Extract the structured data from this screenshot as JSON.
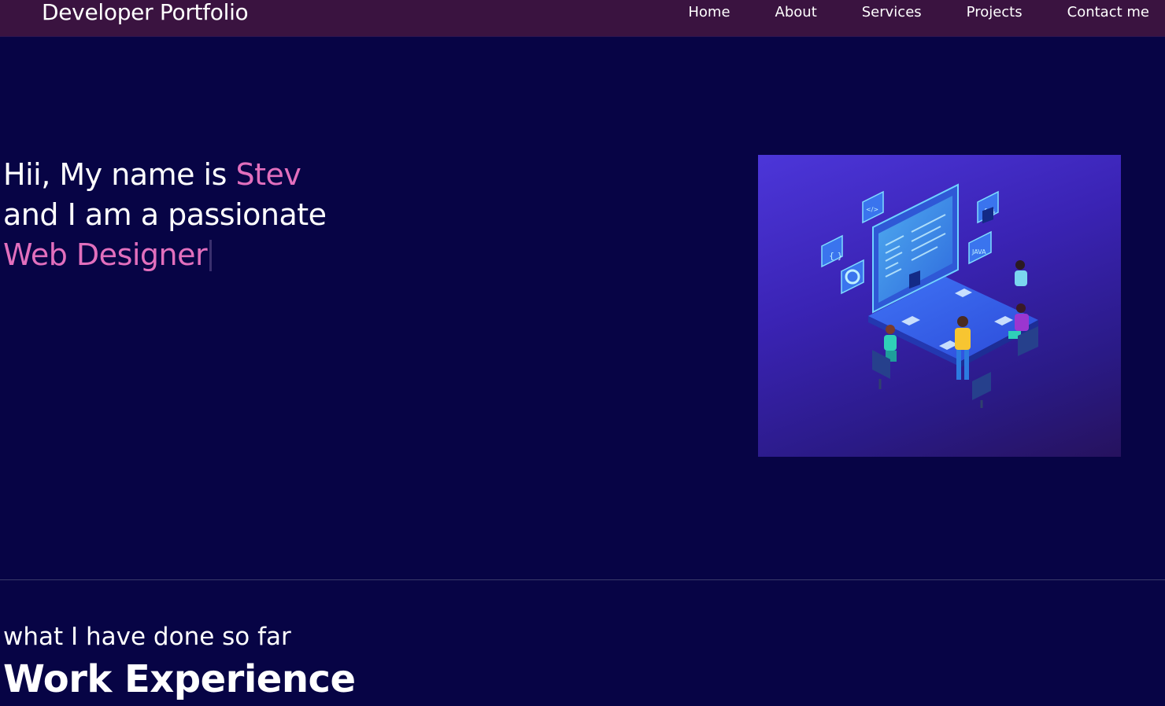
{
  "nav": {
    "brand": "Developer Portfolio",
    "links": [
      "Home",
      "About",
      "Services",
      "Projects",
      "Contact me"
    ]
  },
  "hero": {
    "greeting": "Hii, My name is ",
    "name": "Stev",
    "line2": "and I am a passionate",
    "role": "Web Designer",
    "illustration_icon": "team-coding-illustration"
  },
  "experience": {
    "subtitle": "what I have done so far",
    "title": "Work Experience"
  },
  "colors": {
    "background": "#070445",
    "navbar": "#3a1340",
    "accent": "#e26fbd",
    "text": "#ffffff"
  }
}
